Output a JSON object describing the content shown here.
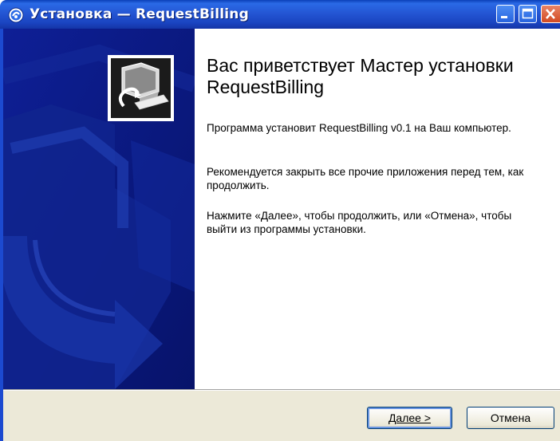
{
  "window": {
    "title": "Установка — RequestBilling"
  },
  "titlebar_buttons": {
    "minimize_icon": "minimize-icon",
    "maximize_icon": "maximize-icon",
    "close_icon": "close-icon"
  },
  "welcome": {
    "title": "Вас приветствует Мастер установки RequestBilling",
    "paragraph1": "Программа установит RequestBilling v0.1 на Ваш компьютер.",
    "paragraph2": "Рекомендуется закрыть все прочие приложения перед тем, как продолжить.",
    "paragraph3": "Нажмите «Далее», чтобы продолжить, или «Отмена», чтобы выйти из программы установки."
  },
  "buttons": {
    "next_label": "Далее >",
    "cancel_label": "Отмена"
  },
  "colors": {
    "titlebar": "#2456d4",
    "sidepanel": "#0b1b8a",
    "button_face": "#ece9d8"
  }
}
